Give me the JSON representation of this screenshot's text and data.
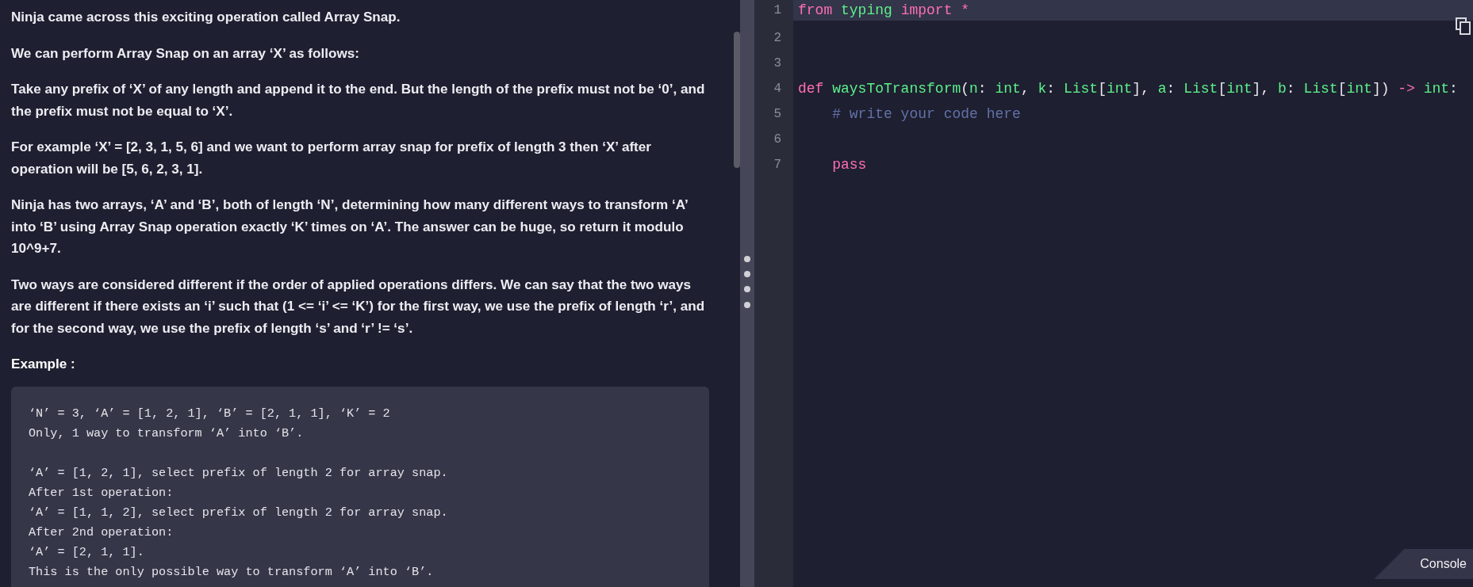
{
  "problem": {
    "paragraphs": [
      "Ninja came across this exciting operation called Array Snap.",
      "We can perform Array Snap on an array ‘X’ as follows:",
      "Take any prefix of ‘X’ of any length and append it to the end. But the length of the prefix must not be ‘0’, and the prefix must not be equal to ‘X’.",
      "For example ‘X’ = [2, 3, 1, 5, 6] and we want to perform array snap for prefix of length 3 then ‘X’ after operation will be [5, 6, 2, 3, 1].",
      "Ninja has two arrays, ‘A’ and ‘B’, both of length ‘N’, determining how many different ways to transform ‘A’ into ‘B’ using Array Snap operation exactly ‘K’ times on ‘A’. The answer can be huge, so return it modulo 10^9+7.",
      "Two ways are considered different if the order of applied operations differs. We can say that the two ways are different if there exists an ‘i’ such that (1 <= ‘i’ <= ‘K’) for the first way, we use the prefix of length ‘r’, and for the second way, we use the prefix of length ‘s’ and ‘r’ != ‘s’."
    ],
    "example_heading": "Example :",
    "example_blocks": [
      [
        "‘N’ = 3, ‘A’ = [1, 2, 1], ‘B’ = [2, 1, 1], ‘K’ = 2",
        "Only, 1 way to transform ‘A’ into ‘B’."
      ],
      [
        "‘A’ = [1, 2, 1], select prefix of length 2 for array snap.",
        "After 1st operation:",
        "‘A’ = [1, 1, 2], select prefix of length 2 for array snap.",
        "After 2nd operation:",
        "‘A’ = [2, 1, 1].",
        "This is the only possible way to transform ‘A’ into ‘B’."
      ]
    ]
  },
  "editor": {
    "lines": [
      {
        "number": "1",
        "highlighted": true,
        "tokens": [
          {
            "kind": "keyword",
            "text": "from"
          },
          {
            "kind": "name",
            "text": " typing"
          },
          {
            "kind": "keyword",
            "text": " import *"
          }
        ]
      },
      {
        "number": "2",
        "highlighted": false
      },
      {
        "number": "3",
        "highlighted": false
      },
      {
        "number": "4",
        "highlighted": false,
        "tokens": [
          {
            "kind": "keyword",
            "text": "def"
          },
          {
            "kind": "name",
            "text": " waysToTransform"
          },
          {
            "kind": "plain",
            "text": "("
          },
          {
            "kind": "name",
            "text": "n"
          },
          {
            "kind": "plain",
            "text": ": "
          },
          {
            "kind": "name",
            "text": "int"
          },
          {
            "kind": "plain",
            "text": ", "
          },
          {
            "kind": "name",
            "text": "k"
          },
          {
            "kind": "plain",
            "text": ": "
          },
          {
            "kind": "name",
            "text": "List"
          },
          {
            "kind": "plain",
            "text": "["
          },
          {
            "kind": "name",
            "text": "int"
          },
          {
            "kind": "plain",
            "text": "], "
          },
          {
            "kind": "name",
            "text": "a"
          },
          {
            "kind": "plain",
            "text": ": "
          },
          {
            "kind": "name",
            "text": "List"
          },
          {
            "kind": "plain",
            "text": "["
          },
          {
            "kind": "name",
            "text": "int"
          },
          {
            "kind": "plain",
            "text": "], "
          },
          {
            "kind": "name",
            "text": "b"
          },
          {
            "kind": "plain",
            "text": ": "
          },
          {
            "kind": "name",
            "text": "List"
          },
          {
            "kind": "plain",
            "text": "["
          },
          {
            "kind": "name",
            "text": "int"
          },
          {
            "kind": "plain",
            "text": "])"
          },
          {
            "kind": "keyword",
            "text": " ->"
          },
          {
            "kind": "name",
            "text": " int"
          },
          {
            "kind": "plain",
            "text": ":"
          }
        ]
      },
      {
        "number": "5",
        "highlighted": false,
        "tokens": [
          {
            "kind": "comment",
            "text": "    # write your code here"
          }
        ]
      },
      {
        "number": "6",
        "highlighted": false
      },
      {
        "number": "7",
        "highlighted": false,
        "tokens": [
          {
            "kind": "keyword",
            "text": "    pass"
          }
        ]
      }
    ]
  },
  "console_tab": {
    "label": "Console"
  }
}
